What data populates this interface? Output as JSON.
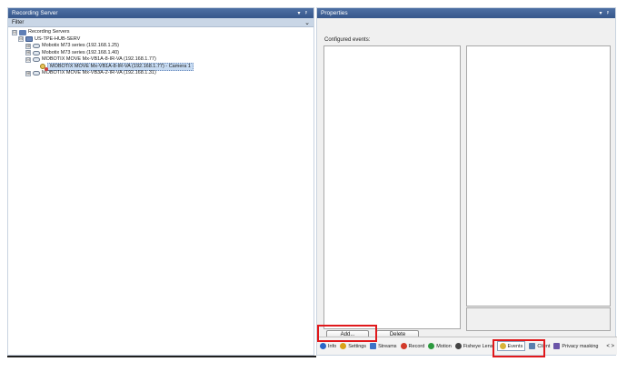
{
  "left_pane": {
    "title": "Recording Server",
    "pin_label": "▾",
    "close_label": "ᵖ",
    "filter_label": "Filter",
    "filter_chevron": "⌄",
    "tree": [
      {
        "label": "Recording Servers",
        "expander": "⊟",
        "icon": "server-group-icon"
      },
      {
        "label": "US-TPE-HUB-SERV",
        "expander": "⊟",
        "icon": "server-icon"
      },
      {
        "label": "Mobotix M73 series (192.168.1.25)",
        "expander": "⊞",
        "icon": "camera-icon"
      },
      {
        "label": "Mobotix M73 series (192.168.1.40)",
        "expander": "⊞",
        "icon": "camera-icon"
      },
      {
        "label": "MOBOTIX MOVE Mx-VB1A-8-IR-VA (192.168.1.77)",
        "expander": "⊟",
        "icon": "camera-icon"
      },
      {
        "label": "MOBOTIX MOVE Mx-VB1A-8-IR-VA (192.168.1.77) - Camera 1",
        "expander": "",
        "icon": "camera-active-icon"
      },
      {
        "label": "MOBOTIX MOVE Mx-VB3A-2-IR-VA (192.168.1.31)",
        "expander": "⊞",
        "icon": "camera-icon"
      }
    ]
  },
  "right_pane": {
    "title": "Properties",
    "pin_label": "▾",
    "close_label": "ᵖ",
    "configured_events_label": "Configured events:",
    "add_button": "Add...",
    "delete_button": "Delete",
    "tabs": [
      {
        "label": "Info",
        "color": "#2a66c8"
      },
      {
        "label": "Settings",
        "color": "#d9a21a"
      },
      {
        "label": "Streams",
        "color": "#3b73c7"
      },
      {
        "label": "Record",
        "color": "#d23a2a"
      },
      {
        "label": "Motion",
        "color": "#2c9a3f"
      },
      {
        "label": "Fisheye Lens",
        "color": "#444444"
      },
      {
        "label": "Events",
        "color": "#d8b43a"
      },
      {
        "label": "Client",
        "color": "#5a7fae"
      },
      {
        "label": "Privacy masking",
        "color": "#6b55a8"
      }
    ],
    "tab_scroll": "< >"
  },
  "colors": {
    "header_blue": "#3f5f93",
    "highlight_red": "#e0191c"
  }
}
